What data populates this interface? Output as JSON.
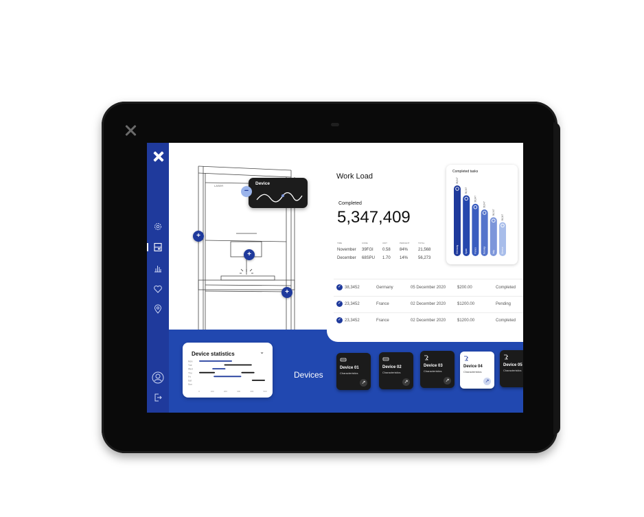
{
  "app": {
    "close_label": "Close"
  },
  "sidebar": {
    "items": [
      {
        "id": "settings",
        "icon": "gear-icon"
      },
      {
        "id": "dashboard",
        "icon": "layout-icon",
        "active": true
      },
      {
        "id": "analytics",
        "icon": "bar-chart-icon"
      },
      {
        "id": "favorites",
        "icon": "heart-icon"
      },
      {
        "id": "location",
        "icon": "location-pin-icon"
      }
    ],
    "bottom": [
      {
        "id": "profile",
        "icon": "user-icon"
      },
      {
        "id": "logout",
        "icon": "logout-icon"
      }
    ]
  },
  "machine": {
    "label": "LASER",
    "tooltip_title": "Device",
    "minus_symbol": "−",
    "plus_symbol": "+"
  },
  "workload": {
    "title": "Work Load",
    "completed_label": "Completed",
    "completed_value": "5,347,409",
    "table": {
      "headers": [
        "Time",
        "Code",
        "Unit",
        "Percent",
        "Total"
      ],
      "rows": [
        [
          "November",
          "39FGI",
          "0.58",
          "84%",
          "21,568"
        ],
        [
          "December",
          "68SPU",
          "1.70",
          "14%",
          "56,273"
        ]
      ]
    }
  },
  "completed_tasks": {
    "title": "Completed tasks",
    "bars": [
      {
        "label": "Germany",
        "value": "38,347",
        "level": 1.0,
        "color": "#1f3a9c"
      },
      {
        "label": "Spain",
        "value": "38,347",
        "level": 0.86,
        "color": "#2547ad"
      },
      {
        "label": "France",
        "value": "38,347",
        "level": 0.74,
        "color": "#3a5dbf"
      },
      {
        "label": "Norway",
        "value": "38,347",
        "level": 0.66,
        "color": "#5574cb"
      },
      {
        "label": "Italy",
        "value": "38,347",
        "level": 0.55,
        "color": "#7d96da"
      },
      {
        "label": "Greece",
        "value": "38,347",
        "level": 0.48,
        "color": "#a8bdea"
      }
    ]
  },
  "transactions": [
    {
      "id": "38,3452",
      "country": "Germany",
      "date": "05 December 2020",
      "amount": "$200.00",
      "status": "Completed"
    },
    {
      "id": "23,3452",
      "country": "France",
      "date": "02 December 2020",
      "amount": "$1200.00",
      "status": "Pending"
    },
    {
      "id": "23,3452",
      "country": "France",
      "date": "02 December 2020",
      "amount": "$1200.00",
      "status": "Completed"
    }
  ],
  "device_statistics": {
    "title": "Device statistics",
    "chevron": "⌄",
    "days": [
      "Mon",
      "Tue",
      "Wed",
      "Thu",
      "Fri",
      "Sat",
      "Sun"
    ],
    "x_ticks": [
      "0",
      "100",
      "200",
      "300",
      "400",
      "500"
    ],
    "segments": [
      {
        "day": "Mon",
        "start": 0,
        "end": 250,
        "color": "#1f3a9c"
      },
      {
        "day": "Tue",
        "start": 190,
        "end": 400,
        "color": "#111111"
      },
      {
        "day": "Wed",
        "start": 100,
        "end": 200,
        "color": "#1f3a9c"
      },
      {
        "day": "Thu",
        "start": 0,
        "end": 120,
        "color": "#111111"
      },
      {
        "day": "Thu",
        "start": 320,
        "end": 420,
        "color": "#111111"
      },
      {
        "day": "Fri",
        "start": 110,
        "end": 320,
        "color": "#1f3a9c"
      },
      {
        "day": "Sat",
        "start": 400,
        "end": 500,
        "color": "#111111"
      }
    ]
  },
  "devices": {
    "section_label": "Devices",
    "items": [
      {
        "name": "Device 01",
        "sub": "Characteristics",
        "icon": "printer-icon",
        "selected": false
      },
      {
        "name": "Device 02",
        "sub": "Characteristics",
        "icon": "printer-icon",
        "selected": false
      },
      {
        "name": "Device 03",
        "sub": "Characteristics",
        "icon": "robot-arm-icon",
        "selected": false
      },
      {
        "name": "Device 04",
        "sub": "Characteristics",
        "icon": "robot-arm-icon",
        "selected": true
      },
      {
        "name": "Device 05",
        "sub": "Characteristics",
        "icon": "robot-arm-icon",
        "selected": false
      }
    ],
    "arrow_symbol": "↗"
  },
  "colors": {
    "primary": "#1f3a9c",
    "band": "#2148b0",
    "dark_card": "#1b1b1b"
  }
}
